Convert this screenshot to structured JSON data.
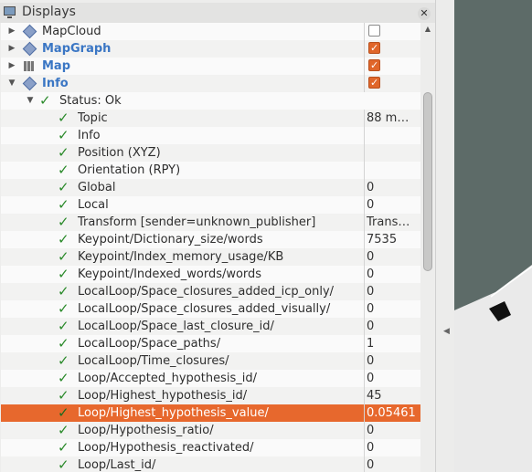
{
  "panel": {
    "title": "Displays"
  },
  "tree_rows": [
    {
      "label": "MapCloud",
      "kind": "display",
      "icon": "diamond-icon",
      "expand": "collapsed",
      "checked": false
    },
    {
      "label": "MapGraph",
      "kind": "display",
      "icon": "diamond-icon",
      "expand": "collapsed",
      "checked": true,
      "bold": true
    },
    {
      "label": "Map",
      "kind": "display",
      "icon": "map-icon",
      "expand": "collapsed",
      "checked": true,
      "bold": true
    },
    {
      "label": "Info",
      "kind": "display",
      "icon": "diamond-icon",
      "expand": "expanded",
      "checked": true,
      "bold": true
    },
    {
      "label": "Status: Ok",
      "kind": "status",
      "expand": "expanded"
    },
    {
      "label": "Topic",
      "kind": "prop",
      "value": "88 m…"
    },
    {
      "label": "Info",
      "kind": "prop",
      "value": ""
    },
    {
      "label": "Position (XYZ)",
      "kind": "prop",
      "value": ""
    },
    {
      "label": "Orientation (RPY)",
      "kind": "prop",
      "value": ""
    },
    {
      "label": "Global",
      "kind": "prop",
      "value": "0"
    },
    {
      "label": "Local",
      "kind": "prop",
      "value": "0"
    },
    {
      "label": "Transform [sender=unknown_publisher]",
      "kind": "prop",
      "value": "Trans…"
    },
    {
      "label": "Keypoint/Dictionary_size/words",
      "kind": "prop",
      "value": "7535"
    },
    {
      "label": "Keypoint/Index_memory_usage/KB",
      "kind": "prop",
      "value": "0"
    },
    {
      "label": "Keypoint/Indexed_words/words",
      "kind": "prop",
      "value": "0"
    },
    {
      "label": "LocalLoop/Space_closures_added_icp_only/",
      "kind": "prop",
      "value": "0"
    },
    {
      "label": "LocalLoop/Space_closures_added_visually/",
      "kind": "prop",
      "value": "0"
    },
    {
      "label": "LocalLoop/Space_last_closure_id/",
      "kind": "prop",
      "value": "0"
    },
    {
      "label": "LocalLoop/Space_paths/",
      "kind": "prop",
      "value": "1"
    },
    {
      "label": "LocalLoop/Time_closures/",
      "kind": "prop",
      "value": "0"
    },
    {
      "label": "Loop/Accepted_hypothesis_id/",
      "kind": "prop",
      "value": "0"
    },
    {
      "label": "Loop/Highest_hypothesis_id/",
      "kind": "prop",
      "value": "45"
    },
    {
      "label": "Loop/Highest_hypothesis_value/",
      "kind": "prop",
      "value": "0.05461",
      "selected": true
    },
    {
      "label": "Loop/Hypothesis_ratio/",
      "kind": "prop",
      "value": "0"
    },
    {
      "label": "Loop/Hypothesis_reactivated/",
      "kind": "prop",
      "value": "0"
    },
    {
      "label": "Loop/Last_id/",
      "kind": "prop",
      "value": "0"
    }
  ],
  "colors": {
    "selected": "#e7682d",
    "check": "#2a8a2a",
    "link_blue": "#3a76c4",
    "map_floor": "#5d6b68"
  }
}
